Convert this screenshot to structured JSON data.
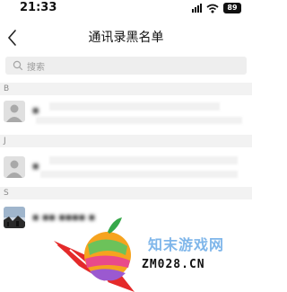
{
  "status_bar": {
    "time": "21:33",
    "battery": "89"
  },
  "header": {
    "title": "通讯录黑名单"
  },
  "search": {
    "placeholder": "搜索"
  },
  "sections": [
    {
      "letter": "B",
      "contact_name": "▪"
    },
    {
      "letter": "J",
      "contact_name": "▪"
    },
    {
      "letter": "S",
      "contact_name": "▪ ▪▪ ▪▪▪▪ ▪"
    }
  ],
  "watermark": {
    "title": "知末游戏网",
    "url": "ZM028.CN"
  }
}
